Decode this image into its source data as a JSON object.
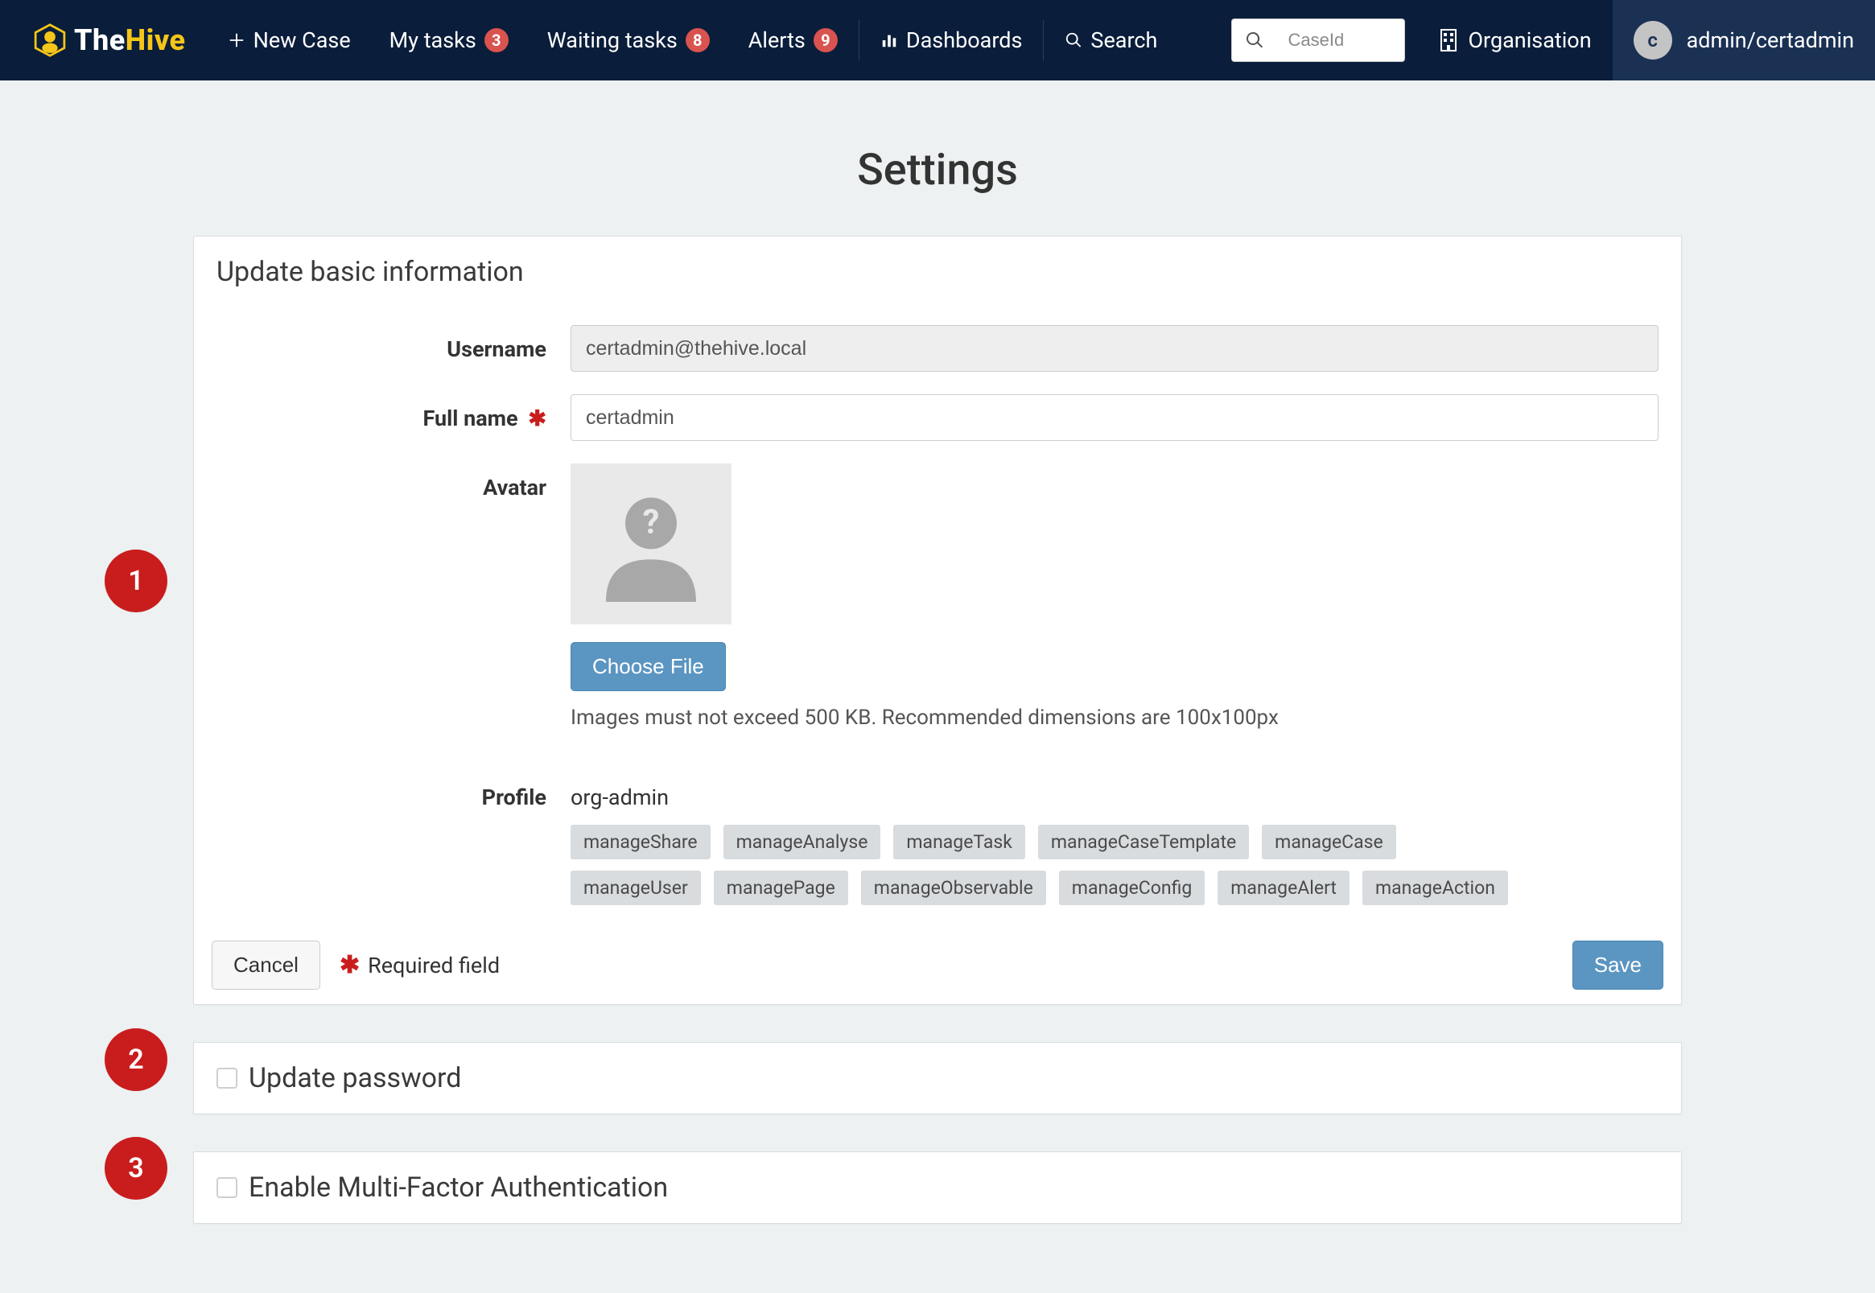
{
  "brand": {
    "the": "The",
    "hive": "Hive"
  },
  "nav": {
    "new_case": "New Case",
    "my_tasks": "My tasks",
    "my_tasks_count": "3",
    "waiting_tasks": "Waiting tasks",
    "waiting_tasks_count": "8",
    "alerts": "Alerts",
    "alerts_count": "9",
    "dashboards": "Dashboards",
    "search": "Search",
    "search_placeholder": "CaseId",
    "organisation": "Organisation",
    "user_initial": "c",
    "user_label": "admin/certadmin"
  },
  "page": {
    "title": "Settings"
  },
  "panels": {
    "basic": {
      "title": "Update basic information",
      "labels": {
        "username": "Username",
        "full_name": "Full name",
        "avatar": "Avatar",
        "profile": "Profile"
      },
      "fields": {
        "username_value": "certadmin@thehive.local",
        "full_name_value": "certadmin"
      },
      "avatar": {
        "choose_file": "Choose File",
        "hint": "Images must not exceed 500 KB. Recommended dimensions are 100x100px"
      },
      "profile": {
        "name": "org-admin",
        "permissions": [
          "manageShare",
          "manageAnalyse",
          "manageTask",
          "manageCaseTemplate",
          "manageCase",
          "manageUser",
          "managePage",
          "manageObservable",
          "manageConfig",
          "manageAlert",
          "manageAction"
        ]
      },
      "footer": {
        "cancel": "Cancel",
        "required_note": "Required field",
        "save": "Save"
      }
    },
    "password": {
      "title": "Update password"
    },
    "mfa": {
      "title": "Enable Multi-Factor Authentication"
    }
  },
  "callouts": {
    "one": "1",
    "two": "2",
    "three": "3"
  }
}
